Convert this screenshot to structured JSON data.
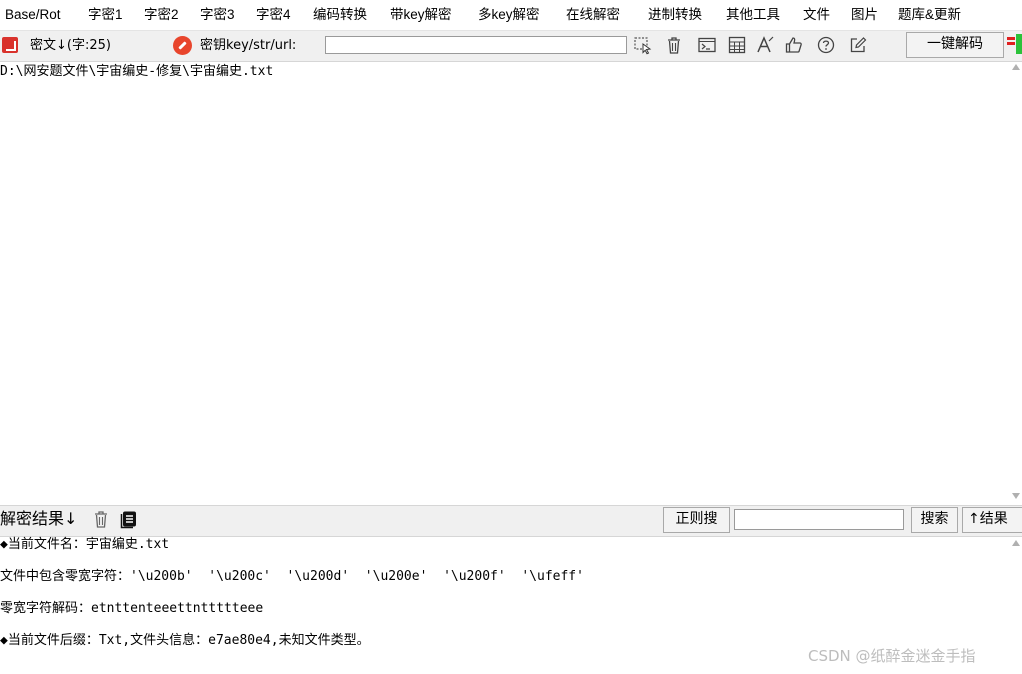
{
  "menu": {
    "items": [
      "Base/Rot",
      "字密1",
      "字密2",
      "字密3",
      "字密4",
      "编码转换",
      "带key解密",
      "多key解密",
      "在线解密",
      "进制转换",
      "其他工具",
      "文件",
      "图片",
      "题库&更新"
    ]
  },
  "toolbar": {
    "cipher_label": "密文↓(字:25)",
    "key_label": "密钥key/str/url:",
    "key_value": "",
    "decode_button": "一键解码",
    "icons": [
      "cursor-select-icon",
      "trash-icon",
      "terminal-icon",
      "calculator-icon",
      "text-a-icon",
      "thumbs-up-icon",
      "help-icon",
      "edit-icon"
    ]
  },
  "ciphertext": "D:\\网安题文件\\宇宙编史-修复\\宇宙编史.txt",
  "result_bar": {
    "label": "解密结果↓",
    "regex_button": "正则搜",
    "search_value": "",
    "search_button": "搜索",
    "up_button": "↑结果"
  },
  "results": {
    "lines": [
      "◆当前文件名：宇宙编史.txt",
      "文件中包含零宽字符：'\\u200b'  '\\u200c'  '\\u200d'  '\\u200e'  '\\u200f'  '\\ufeff'",
      "零宽字符解码：etnttenteeettnttttteee",
      "◆当前文件后缀：Txt,文件头信息：e7ae80e4,未知文件类型。"
    ]
  },
  "watermark": "CSDN @纸醉金迷金手指",
  "colors": {
    "toolbar_bg": "#f0f0f0",
    "accent_red": "#e8452c",
    "accent_green": "#2bc23a"
  }
}
